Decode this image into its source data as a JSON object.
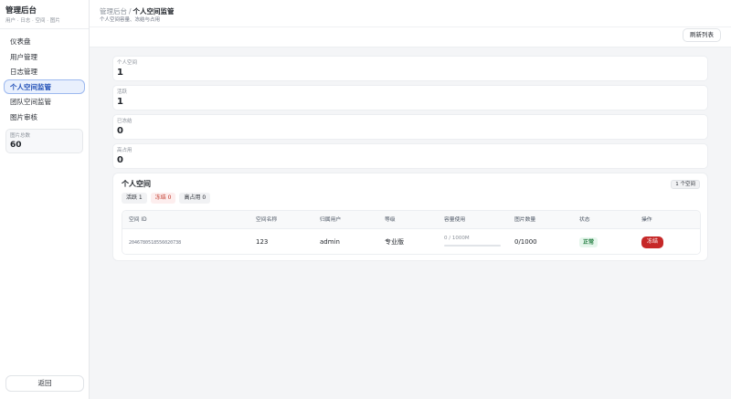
{
  "sidebar": {
    "title": "管理后台",
    "subtitle": "用户 · 日志 · 空间 · 图片",
    "items": [
      {
        "label": "仪表盘"
      },
      {
        "label": "用户管理"
      },
      {
        "label": "日志管理"
      },
      {
        "label": "个人空间监管",
        "active": true
      },
      {
        "label": "团队空间监管"
      },
      {
        "label": "图片审核"
      }
    ],
    "total_images_label": "图片总数",
    "total_images_value": "60",
    "back_label": "返回"
  },
  "header": {
    "crumb_parent": "管理后台",
    "crumb_sep": "/",
    "crumb_current": "个人空间监管",
    "description": "个人空间容量、冻结与占用",
    "refresh_label": "刷新列表"
  },
  "stats": [
    {
      "label": "个人空间",
      "value": "1"
    },
    {
      "label": "活跃",
      "value": "1"
    },
    {
      "label": "已冻结",
      "value": "0"
    },
    {
      "label": "高占用",
      "value": "0"
    }
  ],
  "panel": {
    "title": "个人空间",
    "count_badge": "1 个空间",
    "filters": [
      {
        "label": "活跃 1",
        "tone": "normal"
      },
      {
        "label": "冻结 0",
        "tone": "warn"
      },
      {
        "label": "高占用 0",
        "tone": "normal"
      }
    ],
    "columns": [
      "空间 ID",
      "空间名称",
      "归属用户",
      "等级",
      "容量使用",
      "图片数量",
      "状态",
      "操作"
    ],
    "rows": [
      {
        "id": "2046780518556020738",
        "name": "123",
        "owner": "admin",
        "level": "专业版",
        "usage_text": "0 / 1000M",
        "usage_fraction": 0,
        "images": "0/1000",
        "status": "正常",
        "action": "冻结"
      }
    ]
  },
  "colors": {
    "accent": "#2b6ef2",
    "active_bg": "#e9f0fd",
    "danger": "#c62828",
    "success_bg": "#e6f6ec",
    "success_text": "#1e7a3c"
  }
}
